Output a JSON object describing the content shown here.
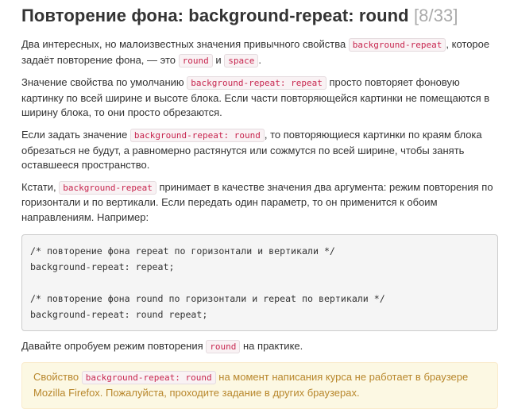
{
  "title": {
    "text": "Повторение фона: background-repeat: round",
    "counter": "[8/33]"
  },
  "para1": {
    "t1": "Два интересных, но малоизвестных значения привычного свойства ",
    "code1": "background-repeat",
    "t2": ", которое задаёт повторение фона, — это ",
    "code2": "round",
    "t3": " и ",
    "code3": "space",
    "t4": "."
  },
  "para2": {
    "t1": "Значение свойства по умолчанию ",
    "code1": "background-repeat: repeat",
    "t2": " просто повторяет фоновую картинку по всей ширине и высоте блока. Если части повторяющейся картинки не помещаются в ширину блока, то они просто обрезаются."
  },
  "para3": {
    "t1": "Если задать значение ",
    "code1": "background-repeat: round",
    "t2": ", то повторяющиеся картинки по краям блока обрезаться не будут, а равномерно растянутся или сожмутся по всей ширине, чтобы занять оставшееся пространство."
  },
  "para4": {
    "t1": "Кстати, ",
    "code1": "background-repeat",
    "t2": " принимает в качестве значения два аргумента: режим повторения по горизонтали и по вертикали. Если передать один параметр, то он применится к обоим направлениям. Например:"
  },
  "code_block": {
    "line1": "/* повторение фона repeat по горизонтали и вертикали */",
    "line2": "background-repeat: repeat;",
    "line3": "",
    "line4": "/* повторение фона round по горизонтали и repeat по вертикали */",
    "line5": "background-repeat: round repeat;"
  },
  "para5": {
    "t1": "Давайте опробуем режим повторения ",
    "code1": "round",
    "t2": " на практике."
  },
  "warning": {
    "t1": "Свойство ",
    "code1": "background-repeat: round",
    "t2": " на момент написания курса не работает в браузере Mozilla Firefox. Пожалуйста, проходите задание в других браузерах."
  },
  "colors": {
    "code_text": "#c7254e",
    "code_bg": "#f9f2f4",
    "warning_text": "#b8872c",
    "warning_bg": "#fcf8e3",
    "counter": "#aaaaaa"
  }
}
